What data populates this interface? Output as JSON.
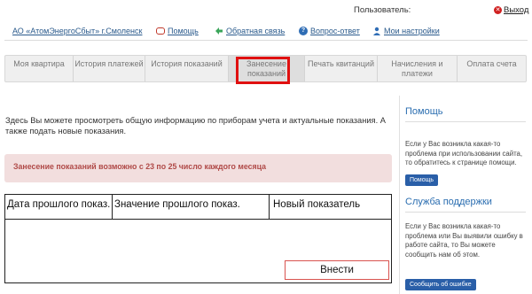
{
  "user_bar": {
    "user_label": "Пользователь:",
    "logout_label": "Выход"
  },
  "top_nav": {
    "company_link": "АО «АтомЭнергоСбыт» г.Смоленск",
    "help": "Помощь",
    "feedback": "Обратная связь",
    "qa": "Вопрос-ответ",
    "settings": "Мои настройки"
  },
  "tabs": [
    {
      "label": "Моя квартира",
      "active": false
    },
    {
      "label": "История платежей",
      "active": false
    },
    {
      "label": "История показаний",
      "active": false
    },
    {
      "label": "Занесение показаний",
      "active": true
    },
    {
      "label": "Печать квитанций",
      "active": false
    },
    {
      "label": "Начисления и платежи",
      "active": false
    },
    {
      "label": "Оплата счета",
      "active": false
    }
  ],
  "main": {
    "intro": "Здесь Вы можете просмотреть общую информацию по приборам учета и актуальные показания. А также подать новые показания.",
    "notice": "Занесение показаний возможно с 23 по 25 число каждого месяца",
    "table": {
      "columns": [
        "Дата прошлого показ.",
        "Значение прошлого показ.",
        "Новый показатель"
      ]
    },
    "submit_label": "Внести"
  },
  "sidebar": {
    "help": {
      "title": "Помощь",
      "text": "Если у Вас возникла какая-то проблема при использовании сайта, то обратитесь к странице помощи.",
      "button": "Помощь"
    },
    "support": {
      "title": "Служба поддержки",
      "text": "Если у Вас возникла какая-то проблема или Вы выявили ошибку в работе сайта, то Вы можете сообщить нам об этом.",
      "button": "Сообщить об ошибке"
    }
  },
  "colors": {
    "accent_link": "#2a5a8c",
    "highlight": "#e01010",
    "notice_bg": "#f2dede",
    "notice_text": "#b04a48",
    "sidebar_button": "#2a5fa8"
  },
  "icons": [
    "logout-icon",
    "help-icon",
    "feedback-icon",
    "question-icon",
    "settings-icon"
  ]
}
